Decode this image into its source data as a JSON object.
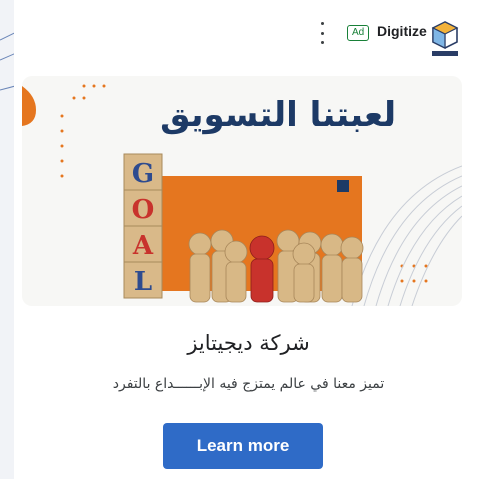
{
  "ad": {
    "badge": "Ad",
    "advertiser": "Digitize",
    "logo_text": "DIGITIZE",
    "menu_icon": "more-vert-icon",
    "hero": {
      "title_part1": "التسويق",
      "title_part2": "لعبتنا",
      "blocks": [
        "G",
        "O",
        "A",
        "L"
      ]
    },
    "headline": "شركة ديجيتايز",
    "description": "تميز معنا في عالم يمتزج فيه الإبــــــداع بالتفرد",
    "cta_label": "Learn more"
  },
  "colors": {
    "cta": "#2f6bc7",
    "ad_badge": "#188038",
    "hero_title": "#1d3a66",
    "hero_orange": "#e5761f",
    "block_red": "#c8322c",
    "block_blue": "#2e4b8f"
  }
}
